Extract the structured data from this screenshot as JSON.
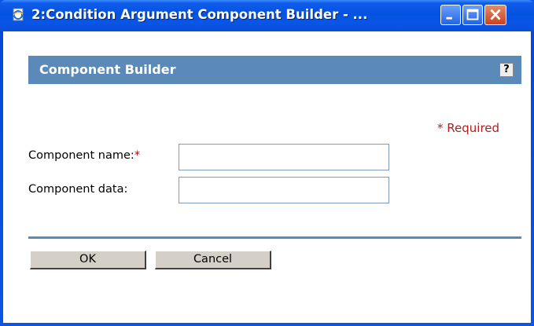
{
  "window": {
    "title": "2:Condition Argument Component Builder - ..."
  },
  "header": {
    "title": "Component Builder",
    "help_label": "?"
  },
  "form": {
    "required_note": "* Required",
    "name_label": "Component name:",
    "name_required_marker": "*",
    "name_value": "",
    "data_label": "Component data:",
    "data_value": ""
  },
  "buttons": {
    "ok_label": "OK",
    "cancel_label": "Cancel"
  },
  "colors": {
    "header_bar": "#5b8ab8",
    "required": "#b02020"
  },
  "icons": {
    "app": "ie-page-icon",
    "minimize": "minimize-icon",
    "maximize": "maximize-icon",
    "close": "close-icon"
  }
}
